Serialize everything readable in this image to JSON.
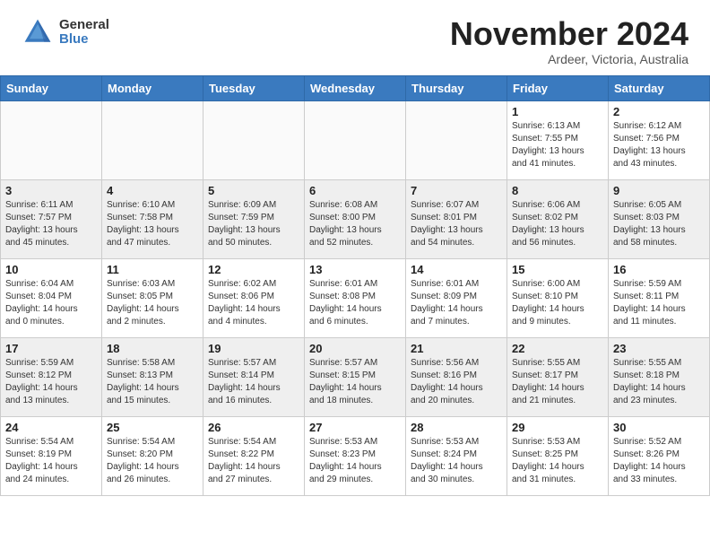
{
  "header": {
    "logo_general": "General",
    "logo_blue": "Blue",
    "month_title": "November 2024",
    "location": "Ardeer, Victoria, Australia"
  },
  "weekdays": [
    "Sunday",
    "Monday",
    "Tuesday",
    "Wednesday",
    "Thursday",
    "Friday",
    "Saturday"
  ],
  "weeks": [
    [
      {
        "day": "",
        "info": ""
      },
      {
        "day": "",
        "info": ""
      },
      {
        "day": "",
        "info": ""
      },
      {
        "day": "",
        "info": ""
      },
      {
        "day": "",
        "info": ""
      },
      {
        "day": "1",
        "info": "Sunrise: 6:13 AM\nSunset: 7:55 PM\nDaylight: 13 hours\nand 41 minutes."
      },
      {
        "day": "2",
        "info": "Sunrise: 6:12 AM\nSunset: 7:56 PM\nDaylight: 13 hours\nand 43 minutes."
      }
    ],
    [
      {
        "day": "3",
        "info": "Sunrise: 6:11 AM\nSunset: 7:57 PM\nDaylight: 13 hours\nand 45 minutes."
      },
      {
        "day": "4",
        "info": "Sunrise: 6:10 AM\nSunset: 7:58 PM\nDaylight: 13 hours\nand 47 minutes."
      },
      {
        "day": "5",
        "info": "Sunrise: 6:09 AM\nSunset: 7:59 PM\nDaylight: 13 hours\nand 50 minutes."
      },
      {
        "day": "6",
        "info": "Sunrise: 6:08 AM\nSunset: 8:00 PM\nDaylight: 13 hours\nand 52 minutes."
      },
      {
        "day": "7",
        "info": "Sunrise: 6:07 AM\nSunset: 8:01 PM\nDaylight: 13 hours\nand 54 minutes."
      },
      {
        "day": "8",
        "info": "Sunrise: 6:06 AM\nSunset: 8:02 PM\nDaylight: 13 hours\nand 56 minutes."
      },
      {
        "day": "9",
        "info": "Sunrise: 6:05 AM\nSunset: 8:03 PM\nDaylight: 13 hours\nand 58 minutes."
      }
    ],
    [
      {
        "day": "10",
        "info": "Sunrise: 6:04 AM\nSunset: 8:04 PM\nDaylight: 14 hours\nand 0 minutes."
      },
      {
        "day": "11",
        "info": "Sunrise: 6:03 AM\nSunset: 8:05 PM\nDaylight: 14 hours\nand 2 minutes."
      },
      {
        "day": "12",
        "info": "Sunrise: 6:02 AM\nSunset: 8:06 PM\nDaylight: 14 hours\nand 4 minutes."
      },
      {
        "day": "13",
        "info": "Sunrise: 6:01 AM\nSunset: 8:08 PM\nDaylight: 14 hours\nand 6 minutes."
      },
      {
        "day": "14",
        "info": "Sunrise: 6:01 AM\nSunset: 8:09 PM\nDaylight: 14 hours\nand 7 minutes."
      },
      {
        "day": "15",
        "info": "Sunrise: 6:00 AM\nSunset: 8:10 PM\nDaylight: 14 hours\nand 9 minutes."
      },
      {
        "day": "16",
        "info": "Sunrise: 5:59 AM\nSunset: 8:11 PM\nDaylight: 14 hours\nand 11 minutes."
      }
    ],
    [
      {
        "day": "17",
        "info": "Sunrise: 5:59 AM\nSunset: 8:12 PM\nDaylight: 14 hours\nand 13 minutes."
      },
      {
        "day": "18",
        "info": "Sunrise: 5:58 AM\nSunset: 8:13 PM\nDaylight: 14 hours\nand 15 minutes."
      },
      {
        "day": "19",
        "info": "Sunrise: 5:57 AM\nSunset: 8:14 PM\nDaylight: 14 hours\nand 16 minutes."
      },
      {
        "day": "20",
        "info": "Sunrise: 5:57 AM\nSunset: 8:15 PM\nDaylight: 14 hours\nand 18 minutes."
      },
      {
        "day": "21",
        "info": "Sunrise: 5:56 AM\nSunset: 8:16 PM\nDaylight: 14 hours\nand 20 minutes."
      },
      {
        "day": "22",
        "info": "Sunrise: 5:55 AM\nSunset: 8:17 PM\nDaylight: 14 hours\nand 21 minutes."
      },
      {
        "day": "23",
        "info": "Sunrise: 5:55 AM\nSunset: 8:18 PM\nDaylight: 14 hours\nand 23 minutes."
      }
    ],
    [
      {
        "day": "24",
        "info": "Sunrise: 5:54 AM\nSunset: 8:19 PM\nDaylight: 14 hours\nand 24 minutes."
      },
      {
        "day": "25",
        "info": "Sunrise: 5:54 AM\nSunset: 8:20 PM\nDaylight: 14 hours\nand 26 minutes."
      },
      {
        "day": "26",
        "info": "Sunrise: 5:54 AM\nSunset: 8:22 PM\nDaylight: 14 hours\nand 27 minutes."
      },
      {
        "day": "27",
        "info": "Sunrise: 5:53 AM\nSunset: 8:23 PM\nDaylight: 14 hours\nand 29 minutes."
      },
      {
        "day": "28",
        "info": "Sunrise: 5:53 AM\nSunset: 8:24 PM\nDaylight: 14 hours\nand 30 minutes."
      },
      {
        "day": "29",
        "info": "Sunrise: 5:53 AM\nSunset: 8:25 PM\nDaylight: 14 hours\nand 31 minutes."
      },
      {
        "day": "30",
        "info": "Sunrise: 5:52 AM\nSunset: 8:26 PM\nDaylight: 14 hours\nand 33 minutes."
      }
    ]
  ]
}
